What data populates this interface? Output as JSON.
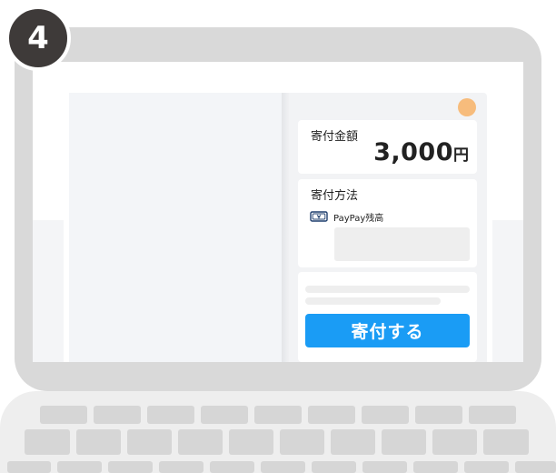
{
  "step_badge": "4",
  "donation": {
    "amount_label": "寄付金額",
    "amount_value": "3,000",
    "amount_unit": "円",
    "method_label": "寄付方法",
    "method_option": "PayPay残高",
    "method_icon": "yen-bill-icon",
    "submit_label": "寄付する"
  },
  "colors": {
    "accent": "#1a9cf5",
    "badge": "#3e3a39",
    "avatar": "#f7bc7c"
  }
}
